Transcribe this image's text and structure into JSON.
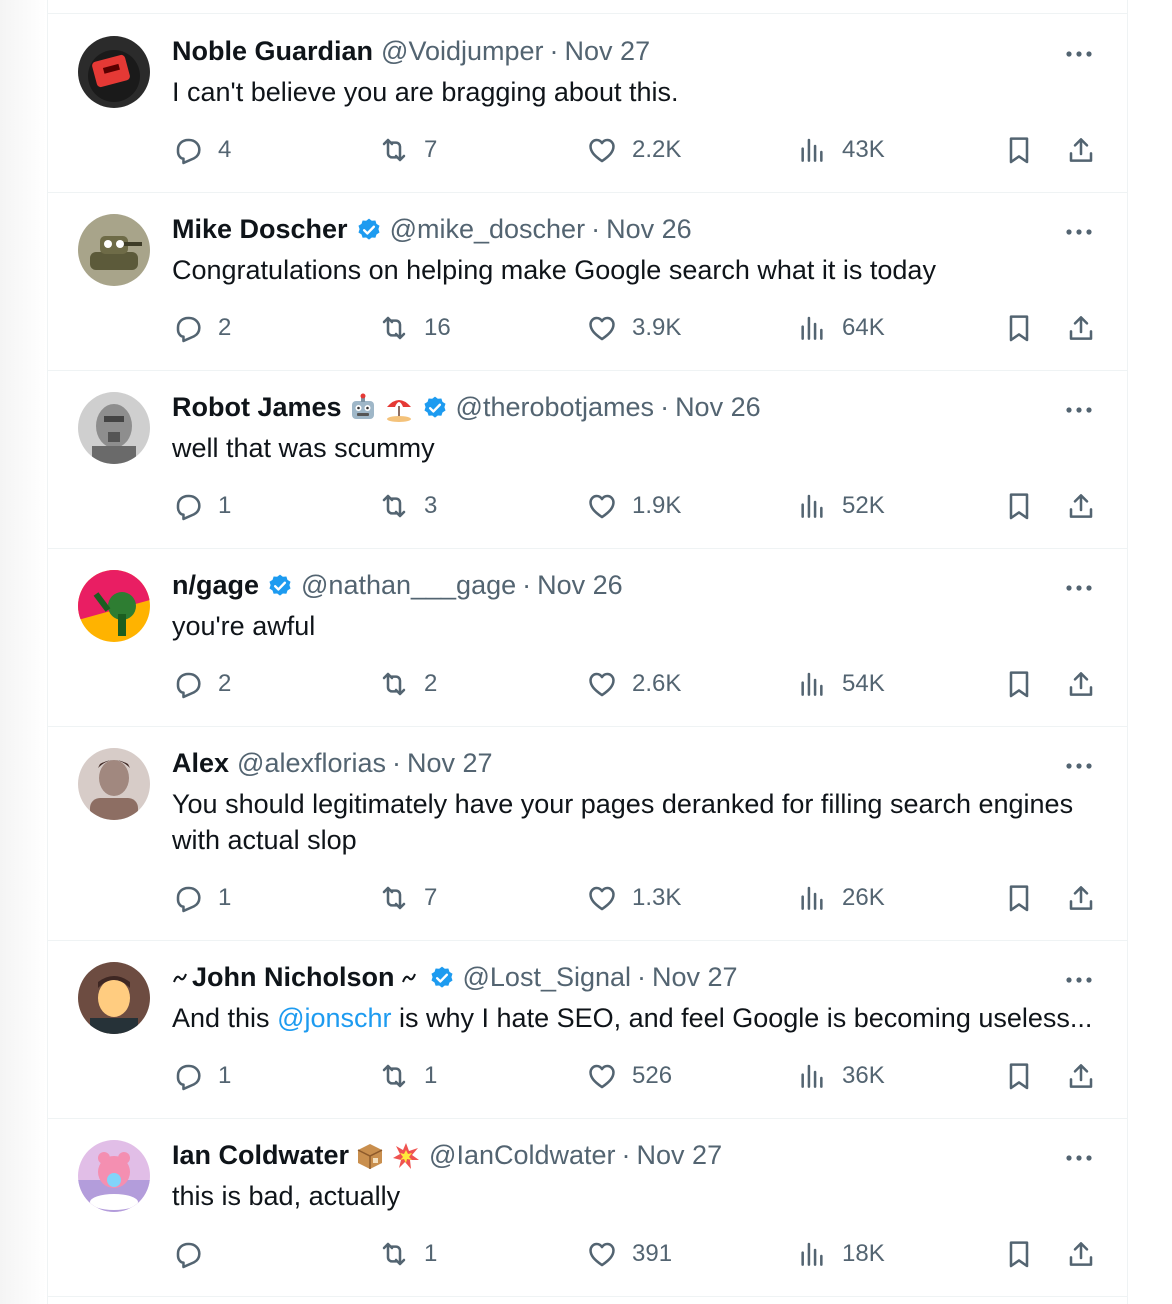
{
  "replies": [
    {
      "name": "Noble Guardian",
      "handle": "@Voidjumper",
      "date": "Nov 27",
      "text": "I can't believe you are bragging about this.",
      "replies": "4",
      "reposts": "7",
      "likes": "2.2K",
      "views": "43K",
      "verified": false,
      "avatar_color": "#c0392b"
    },
    {
      "name": "Mike Doscher",
      "handle": "@mike_doscher",
      "date": "Nov 26",
      "text": "Congratulations on helping make Google search what it is today",
      "replies": "2",
      "reposts": "16",
      "likes": "3.9K",
      "views": "64K",
      "verified": true,
      "avatar_color": "#6b6b48"
    },
    {
      "name": "Robot James",
      "handle": "@therobotjames",
      "date": "Nov 26",
      "text": "well that was scummy",
      "replies": "1",
      "reposts": "3",
      "likes": "1.9K",
      "views": "52K",
      "verified": true,
      "emojis": [
        "robot-face-emoji",
        "beach-umbrella-emoji"
      ],
      "avatar_color": "#9a9a9a"
    },
    {
      "name": "n/gage",
      "handle": "@nathan___gage",
      "date": "Nov 26",
      "text": "you're awful",
      "replies": "2",
      "reposts": "2",
      "likes": "2.6K",
      "views": "54K",
      "verified": true,
      "avatar_color": "#e91e63"
    },
    {
      "name": "Alex",
      "handle": "@alexflorias",
      "date": "Nov 27",
      "text": "You should legitimately have your pages deranked for filling search engines with actual slop",
      "replies": "1",
      "reposts": "7",
      "likes": "1.3K",
      "views": "26K",
      "verified": false,
      "avatar_color": "#8d6e63"
    },
    {
      "name": "John Nicholson",
      "handle": "@Lost_Signal",
      "date": "Nov 27",
      "text_before": "And this ",
      "mention": "@jonschr",
      "text_after": " is why I hate SEO, and feel Google is becoming useless...",
      "replies": "1",
      "reposts": "1",
      "likes": "526",
      "views": "36K",
      "verified": true,
      "avatar_color": "#795548"
    },
    {
      "name": "Ian Coldwater",
      "handle": "@IanColdwater",
      "date": "Nov 27",
      "text": "this is bad, actually",
      "replies": "",
      "reposts": "1",
      "likes": "391",
      "views": "18K",
      "verified": false,
      "emojis": [
        "package-emoji",
        "collision-emoji"
      ],
      "avatar_color": "#ce93d8"
    }
  ],
  "colors": {
    "accent": "#1d9bf0",
    "muted": "#536471",
    "text": "#0f1419",
    "divider": "#eff3f4"
  }
}
